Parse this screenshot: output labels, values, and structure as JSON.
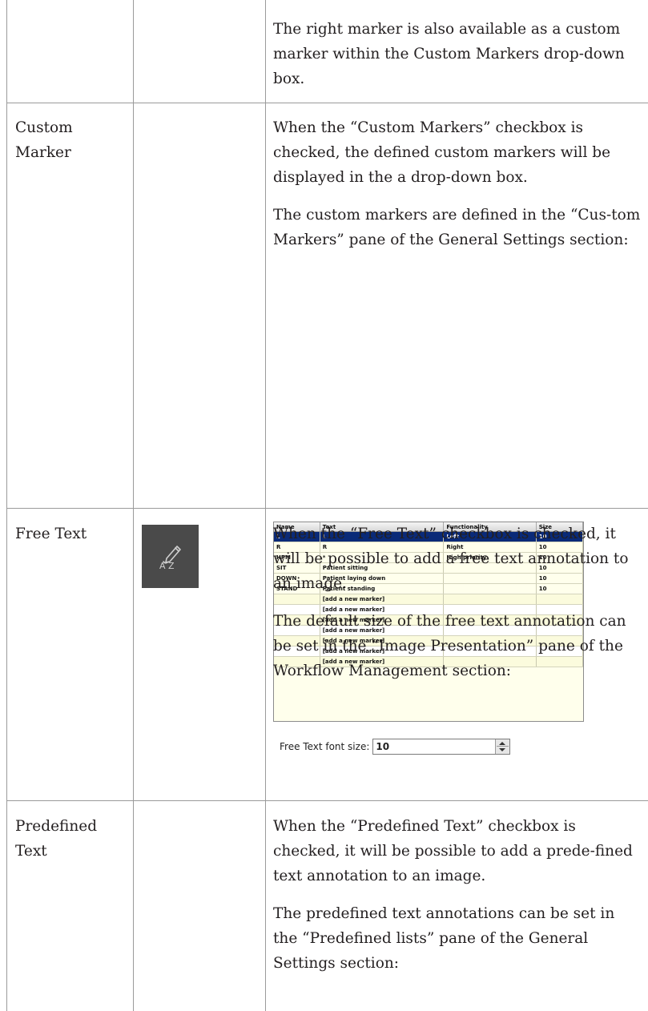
{
  "rows": [
    {
      "label": "",
      "paragraphs": [
        "The right marker is also available as a custom marker within the Custom Markers drop-down box."
      ]
    },
    {
      "label": "Custom Marker",
      "paragraphs": [
        "When the “Custom Markers” checkbox is checked, the defined custom markers will be displayed in the a drop-down box.",
        "The custom markers are defined in the “Cus-tom Markers” pane of the General Settings section:"
      ]
    },
    {
      "label": "Free Text",
      "icon": "free-text-annotation-icon",
      "icon_text": "A Z",
      "paragraphs": [
        "When the “Free Text” checkbox is checked, it will be possible to add a free text annotation to an image.",
        "The default size of the free text annotation can be set in the “Image Presentation” pane of the Workflow Management section:"
      ]
    },
    {
      "label": "Predefined Text",
      "paragraphs": [
        "When the “Predefined Text” checkbox is checked, it will be possible to add a prede-fined text annotation to an image.",
        "The predefined text annotations can be set in the “Predefined lists” pane of the General Settings section:"
      ]
    }
  ],
  "markers_table": {
    "columns": [
      "Name",
      "Text",
      "Functionality",
      "Size"
    ],
    "rows": [
      [
        "L",
        "L",
        "Left",
        "10"
      ],
      [
        "R",
        "R",
        "Right",
        "10"
      ],
      [
        "HPM",
        "*",
        "High priority",
        "10"
      ],
      [
        "SIT",
        "Patient sitting",
        "",
        "10"
      ],
      [
        "DOWN",
        "Patient laying down",
        "",
        "10"
      ],
      [
        "STAND",
        "Patient standing",
        "",
        "10"
      ],
      [
        "",
        "[add a new marker]",
        "",
        ""
      ],
      [
        "",
        "[add a new marker]",
        "",
        ""
      ],
      [
        "",
        "[add a new marker]",
        "",
        ""
      ],
      [
        "",
        "[add a new marker]",
        "",
        ""
      ],
      [
        "",
        "[add a new marker]",
        "",
        ""
      ],
      [
        "",
        "[add a new marker]",
        "",
        ""
      ],
      [
        "",
        "[add a new marker]",
        "",
        ""
      ]
    ],
    "selected_row": 0,
    "colors": {
      "selected_bg": "#0a2a78",
      "row_bg": "#ffffec"
    }
  },
  "font_size_control": {
    "label": "Free Text font size:",
    "value": "10"
  }
}
